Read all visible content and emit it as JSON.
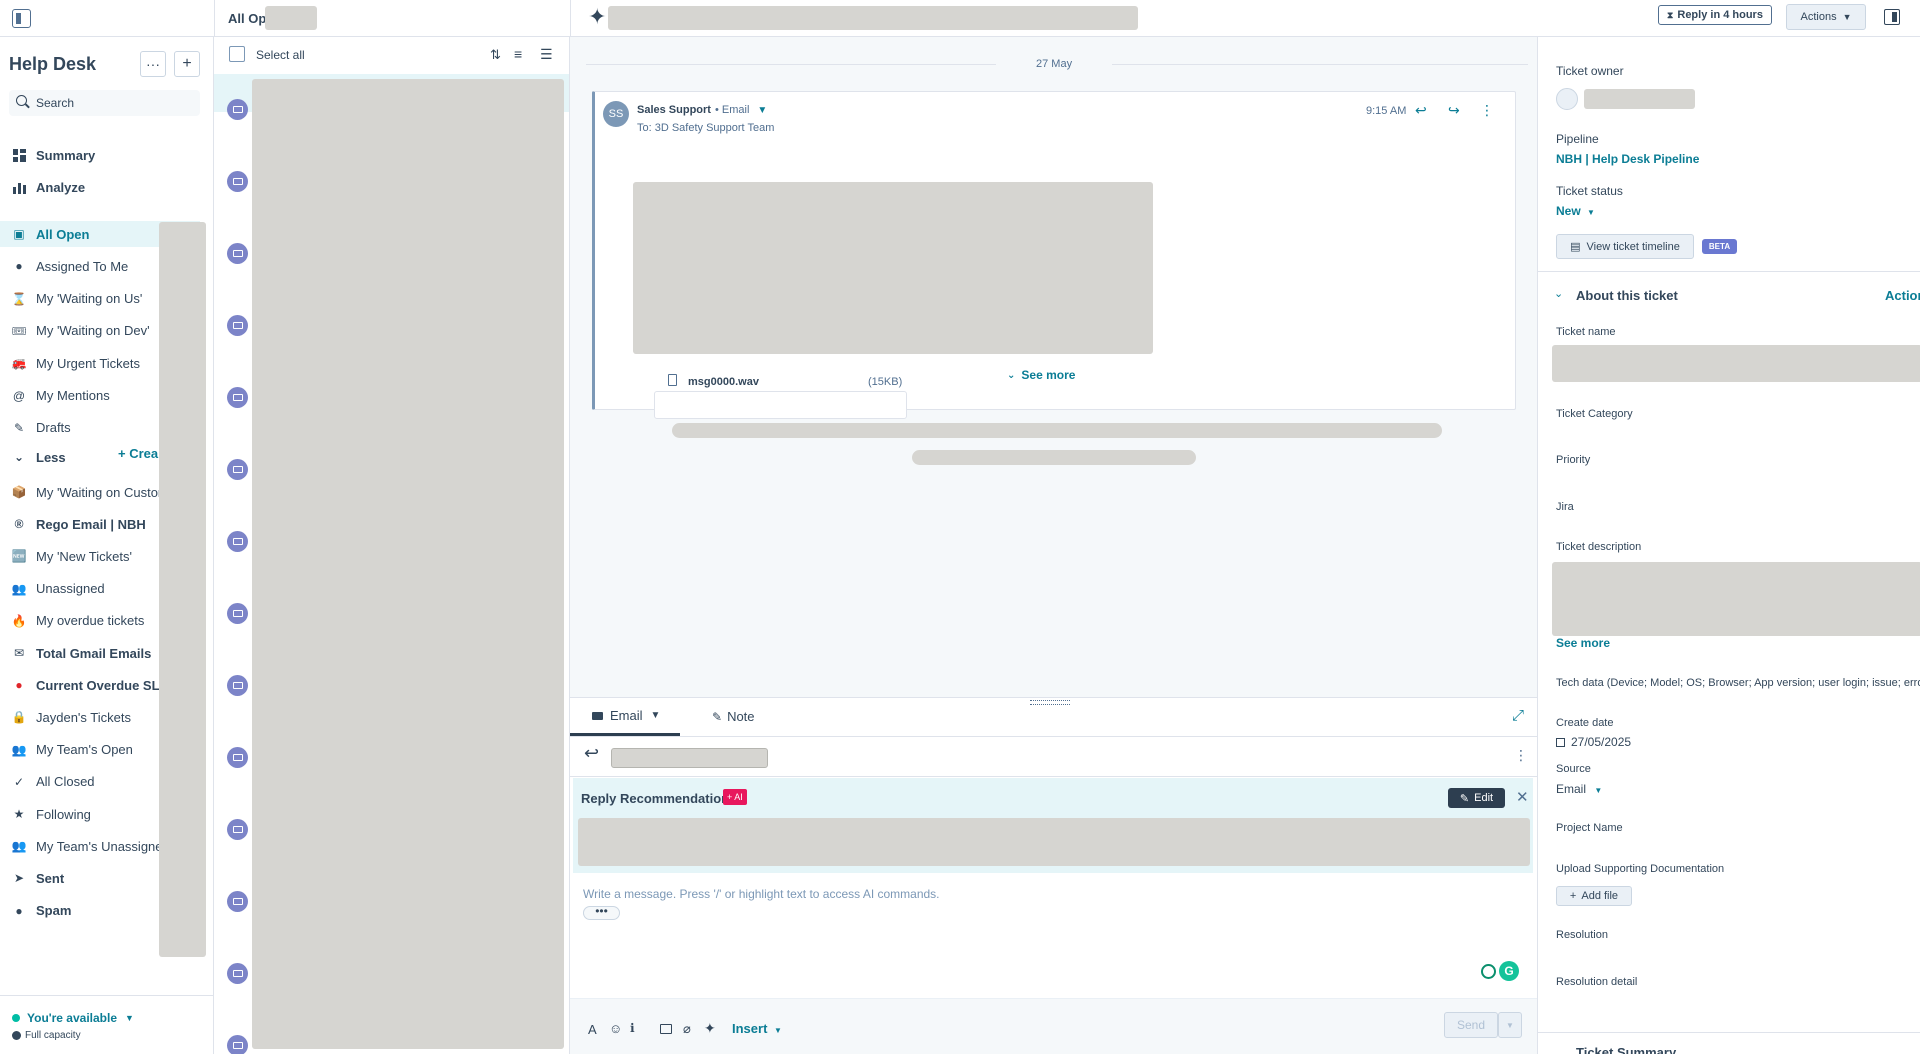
{
  "topbar": {
    "list_title": "All Op",
    "reply_badge": "Reply in 4 hours",
    "actions_label": "Actions"
  },
  "sidebar": {
    "title": "Help Desk",
    "search_placeholder": "Search",
    "summary": "Summary",
    "analyze": "Analyze",
    "items": [
      {
        "label": "All Open",
        "icon": "inbox-icon"
      },
      {
        "label": "Assigned To Me",
        "icon": "avatar-icon"
      },
      {
        "label": "My 'Waiting on Us'",
        "icon": "hourglass-icon"
      },
      {
        "label": "My 'Waiting on Dev'",
        "icon": "ticket-emoji-icon"
      },
      {
        "label": "My Urgent Tickets",
        "icon": "fire-truck-icon"
      },
      {
        "label": "My Mentions",
        "icon": "at-icon"
      },
      {
        "label": "Drafts",
        "icon": "pencil-icon"
      }
    ],
    "less_label": "Less",
    "create_label": "+ Crea",
    "more_items": [
      {
        "label": "My 'Waiting on Custom",
        "icon": "package-icon"
      },
      {
        "label": "Rego Email | NBH",
        "icon": "registered-icon"
      },
      {
        "label": "My 'New Tickets'",
        "icon": "new-badge-icon"
      },
      {
        "label": "Unassigned",
        "icon": "people-icon"
      },
      {
        "label": "My overdue tickets",
        "icon": "fire-icon"
      },
      {
        "label": "Total Gmail Emails",
        "icon": "envelope-icon"
      },
      {
        "label": "Current Overdue SLA",
        "icon": "red-circle-icon"
      },
      {
        "label": "Jayden's Tickets",
        "icon": "lock-icon"
      },
      {
        "label": "My Team's Open",
        "icon": "team-icon"
      },
      {
        "label": "All Closed",
        "icon": "check-icon"
      },
      {
        "label": "Following",
        "icon": "star-icon"
      },
      {
        "label": "My Team's Unassigned",
        "icon": "team-icon"
      },
      {
        "label": "Sent",
        "icon": "send-icon"
      },
      {
        "label": "Spam",
        "icon": "alert-icon"
      }
    ],
    "availability": "You're available",
    "capacity": "Full capacity"
  },
  "list": {
    "select_all": "Select all"
  },
  "thread": {
    "date_divider": "27 May",
    "avatar_initials": "SS",
    "sender": "Sales Support",
    "channel": "• Email",
    "to": "To: 3D Safety Support Team",
    "time": "9:15 AM",
    "see_more": "See more",
    "attachment_name": "msg0000.wav",
    "attachment_size": "(15KB)"
  },
  "composer": {
    "tab_email": "Email",
    "tab_note": "Note",
    "reco_title": "Reply Recommendation",
    "ai_badge": "+ AI",
    "edit_label": "Edit",
    "placeholder": "Write a message. Press '/' or highlight text to access AI commands.",
    "insert_label": "Insert",
    "send_label": "Send"
  },
  "details": {
    "owner_label": "Ticket owner",
    "pipeline_label": "Pipeline",
    "pipeline_value": "NBH | Help Desk Pipeline",
    "status_label": "Ticket status",
    "status_value": "New",
    "timeline_btn": "View ticket timeline",
    "beta": "BETA",
    "about_title": "About this ticket",
    "about_actions": "Actions",
    "fields": {
      "ticket_name": "Ticket name",
      "category": "Ticket Category",
      "priority": "Priority",
      "jira": "Jira",
      "description": "Ticket description",
      "see_more": "See more",
      "tech_data": "Tech data (Device; Model; OS; Browser; App version; user login; issue; error m",
      "create_date": "Create date",
      "create_date_value": "27/05/2025",
      "source": "Source",
      "source_value": "Email",
      "project": "Project Name",
      "upload": "Upload Supporting Documentation",
      "add_file": "Add file",
      "resolution": "Resolution",
      "resolution_detail": "Resolution detail",
      "ticket_summary": "Ticket Summary"
    }
  },
  "colors": {
    "accent": "#0b7d95",
    "badge": "#7c84c8",
    "ai": "#e8175d",
    "edit_bg": "#2d3e50"
  }
}
